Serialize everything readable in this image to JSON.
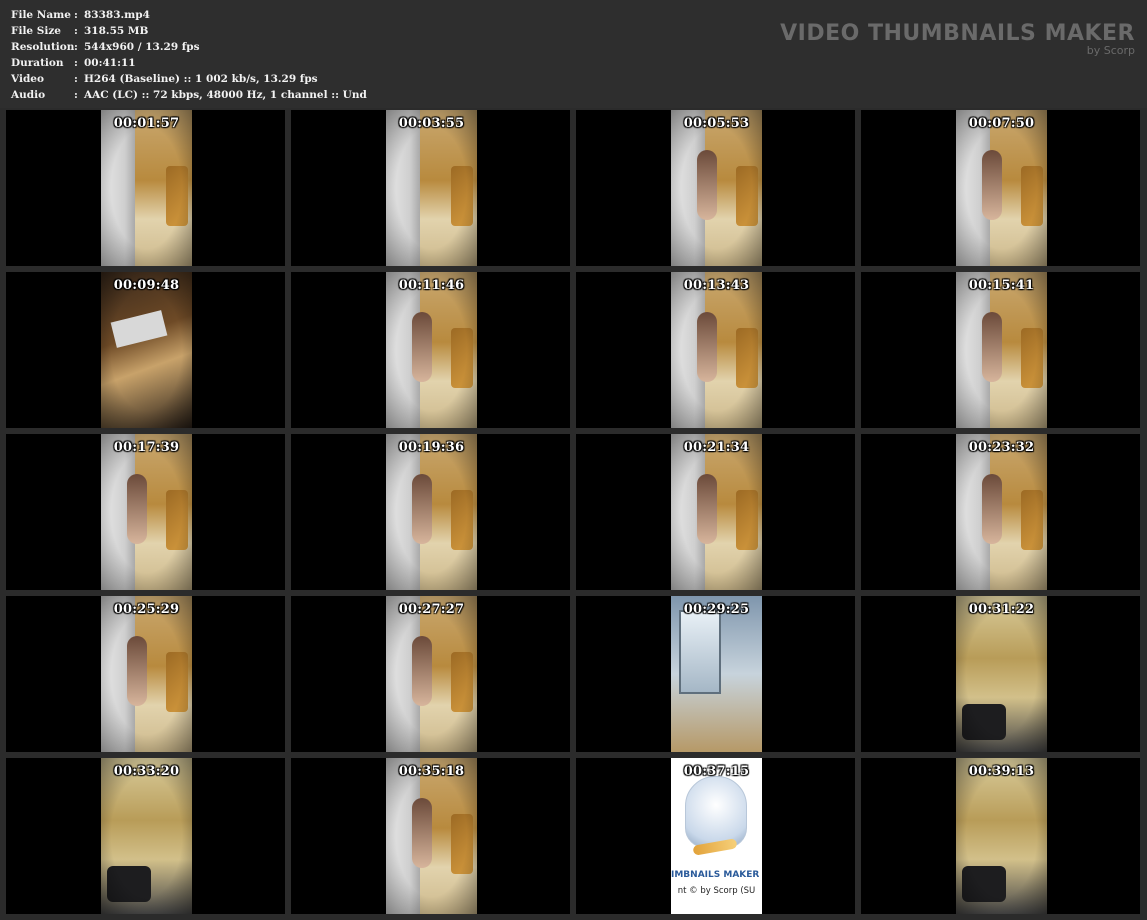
{
  "info": {
    "rows": [
      {
        "label": "File Name",
        "value": "83383.mp4"
      },
      {
        "label": "File Size",
        "value": "318.55 MB"
      },
      {
        "label": "Resolution",
        "value": "544x960 / 13.29 fps"
      },
      {
        "label": "Duration",
        "value": "00:41:11"
      },
      {
        "label": "Video",
        "value": "H264 (Baseline) :: 1 002 kb/s, 13.29 fps"
      },
      {
        "label": "Audio",
        "value": "AAC (LC) :: 72 kbps, 48000 Hz, 1 channel :: Und"
      }
    ],
    "separator": ":"
  },
  "brand": {
    "title": "VIDEO THUMBNAILS MAKER",
    "subtitle": "by Scorp"
  },
  "thumbnails": [
    {
      "time": "00:01:57",
      "scene": "bed"
    },
    {
      "time": "00:03:55",
      "scene": "bed"
    },
    {
      "time": "00:05:53",
      "scene": "bed-figure"
    },
    {
      "time": "00:07:50",
      "scene": "bed-figure"
    },
    {
      "time": "00:09:48",
      "scene": "blur"
    },
    {
      "time": "00:11:46",
      "scene": "bed-figure"
    },
    {
      "time": "00:13:43",
      "scene": "bed-figure"
    },
    {
      "time": "00:15:41",
      "scene": "bed-figure"
    },
    {
      "time": "00:17:39",
      "scene": "bed-figure"
    },
    {
      "time": "00:19:36",
      "scene": "bed-figure"
    },
    {
      "time": "00:21:34",
      "scene": "bed-figure"
    },
    {
      "time": "00:23:32",
      "scene": "bed-figure"
    },
    {
      "time": "00:25:29",
      "scene": "bed-figure"
    },
    {
      "time": "00:27:27",
      "scene": "bed-figure"
    },
    {
      "time": "00:29:25",
      "scene": "window"
    },
    {
      "time": "00:31:22",
      "scene": "room"
    },
    {
      "time": "00:33:20",
      "scene": "room"
    },
    {
      "time": "00:35:18",
      "scene": "bed-figure"
    },
    {
      "time": "00:37:15",
      "scene": "logo",
      "logo_text": "IMBNAILS MAKER 8",
      "logo_copy": "nt © by Scorp (SU"
    },
    {
      "time": "00:39:13",
      "scene": "room"
    }
  ]
}
